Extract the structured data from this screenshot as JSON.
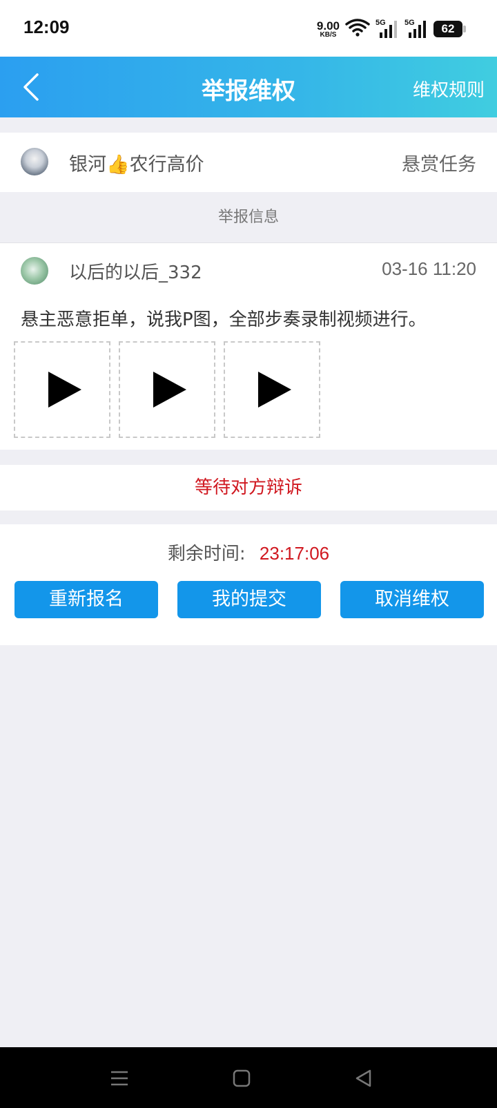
{
  "status_bar": {
    "time": "12:09",
    "net_speed_value": "9.00",
    "net_speed_unit": "KB/S",
    "signal1_label": "5G",
    "signal2_label": "5G",
    "battery": "62"
  },
  "nav": {
    "back_icon": "chevron-left-icon",
    "title": "举报维权",
    "rules_link": "维权规则"
  },
  "task": {
    "title": "银河👍农行高价",
    "type": "悬赏任务"
  },
  "report_section_header": "举报信息",
  "report": {
    "reporter": "以后的以后_332",
    "time": "03-16 11:20",
    "text": "悬主恶意拒单，说我P图，全部步奏录制视频进行。",
    "videos": [
      {
        "icon": "play-icon"
      },
      {
        "icon": "play-icon"
      },
      {
        "icon": "play-icon"
      }
    ]
  },
  "status_text": "等待对方辩诉",
  "remaining": {
    "label": "剩余时间:",
    "value": "23:17:06"
  },
  "actions": {
    "re_signup": "重新报名",
    "my_submission": "我的提交",
    "cancel_dispute": "取消维权"
  },
  "colors": {
    "nav_gradient_start": "#2b9ff0",
    "nav_gradient_end": "#40cde0",
    "button": "#1396ea",
    "alert_red": "#d0171f",
    "background": "#efeff4"
  },
  "system_nav": {
    "menu_icon": "menu-icon",
    "home_icon": "home-icon",
    "back_icon": "back-triangle-icon"
  }
}
